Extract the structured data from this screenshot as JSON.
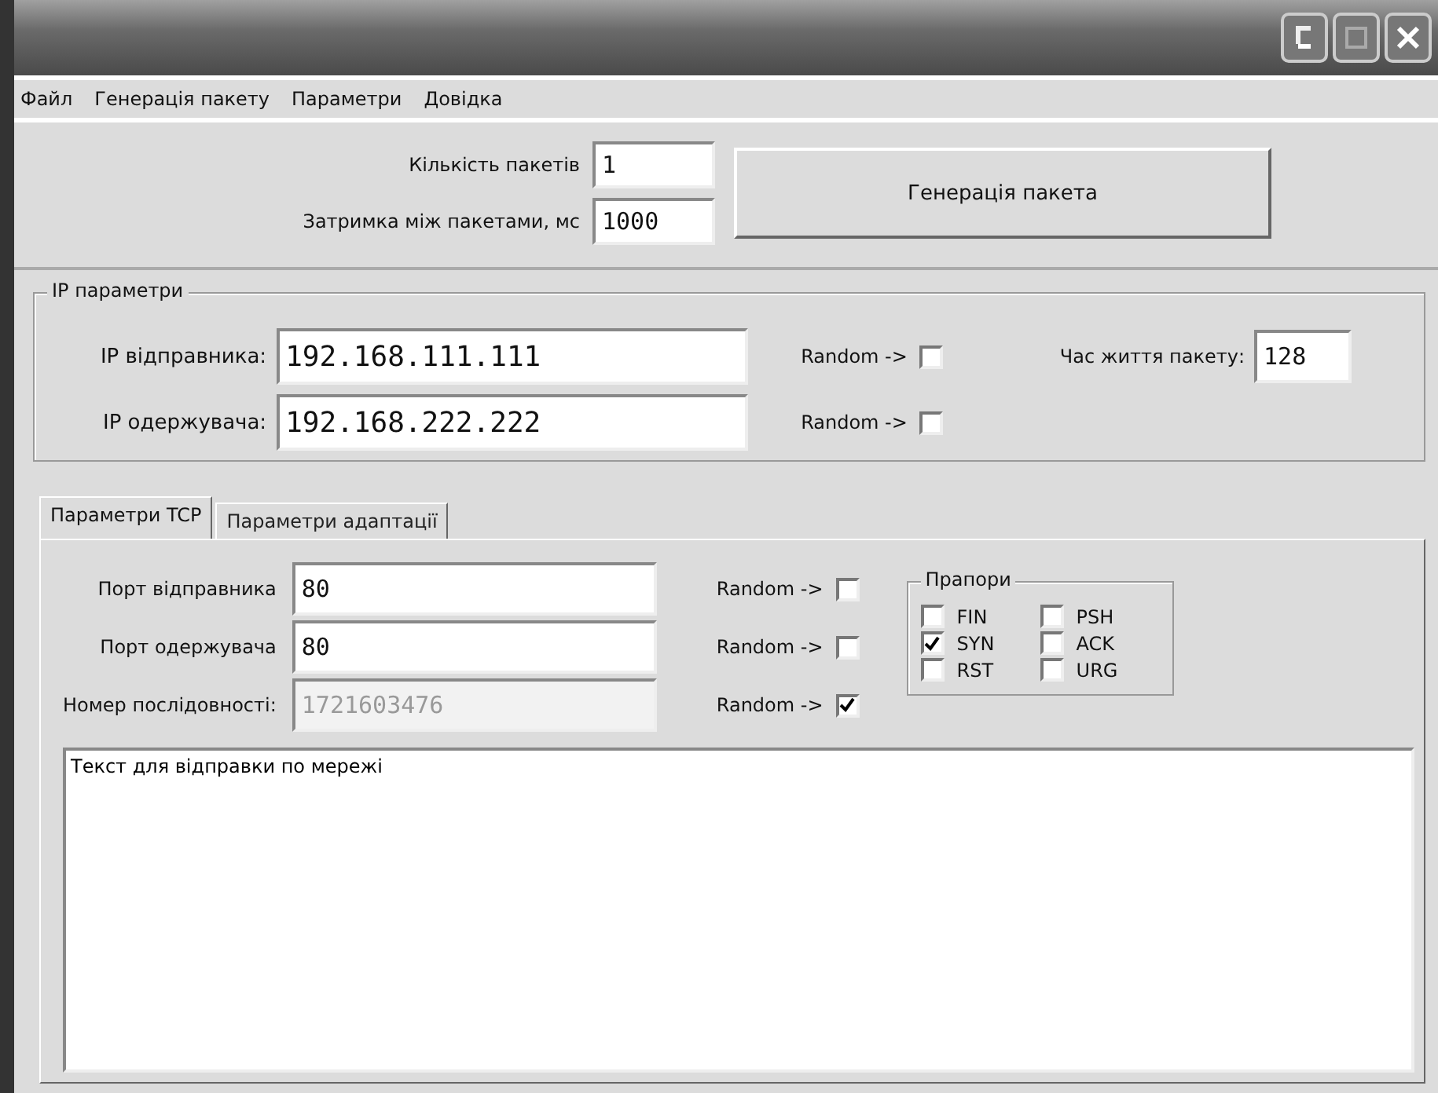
{
  "menu": [
    "Файл",
    "Генерація пакету",
    "Параметри",
    "Довідка"
  ],
  "generation": {
    "fields": [
      {
        "label": "Кількість пакетів",
        "value": "1"
      },
      {
        "label": "Затримка між пакетами, мс",
        "value": "1000"
      }
    ],
    "button": "Генерація пакета"
  },
  "ip_group": {
    "title": "IP параметри",
    "fields": [
      {
        "label": "IP відправника:",
        "value": "192.168.111.111",
        "random_label": "Random ->",
        "random_checked": false
      },
      {
        "label": "IP одержувача:",
        "value": "192.168.222.222",
        "random_label": "Random ->",
        "random_checked": false
      }
    ],
    "ttl": {
      "label": "Час життя пакету:",
      "value": "128"
    }
  },
  "tabs": [
    {
      "label": "Параметри TCP",
      "selected": true
    },
    {
      "label": "Параметри адаптації",
      "selected": false
    }
  ],
  "tcp": {
    "fields": [
      {
        "label": "Порт відправника",
        "value": "80",
        "disabled": false,
        "random_label": "Random ->",
        "random_checked": false
      },
      {
        "label": "Порт одержувача",
        "value": "80",
        "disabled": false,
        "random_label": "Random ->",
        "random_checked": false
      },
      {
        "label": "Номер послідовності:",
        "value": "1721603476",
        "disabled": true,
        "random_label": "Random ->",
        "random_checked": true
      }
    ],
    "flags_title": "Прапори",
    "flags": [
      {
        "label": "FIN",
        "checked": false
      },
      {
        "label": "PSH",
        "checked": false
      },
      {
        "label": "SYN",
        "checked": true
      },
      {
        "label": "ACK",
        "checked": false
      },
      {
        "label": "RST",
        "checked": false
      },
      {
        "label": "URG",
        "checked": false
      }
    ],
    "message": "Текст для відправки по мережі"
  }
}
